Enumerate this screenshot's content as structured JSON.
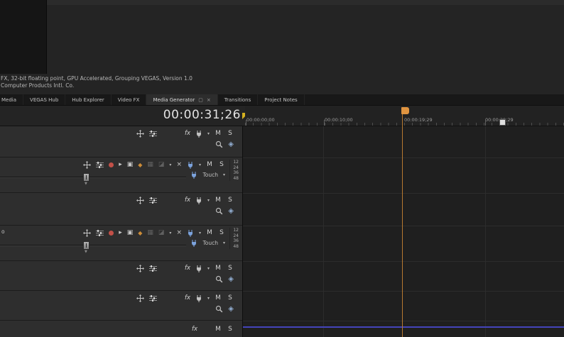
{
  "status_bar": {
    "line1": "FX, 32-bit floating point, GPU Accelerated, Grouping VEGAS, Version 1.0",
    "line2": "Computer Products Intl. Co."
  },
  "tab_bar": {
    "tabs": [
      {
        "label": "Media",
        "active": false
      },
      {
        "label": "VEGAS Hub",
        "active": false
      },
      {
        "label": "Hub Explorer",
        "active": false
      },
      {
        "label": "Video FX",
        "active": false
      },
      {
        "label": "Media Generator",
        "active": true
      },
      {
        "label": "Transitions",
        "active": false
      },
      {
        "label": "Project Notes",
        "active": false
      }
    ]
  },
  "time_display": {
    "value": "00:00:31;26"
  },
  "ruler": {
    "labels": [
      "00:00:00;00",
      "00:00:10;00",
      "00:00:19;29",
      "00:00:29;29"
    ]
  },
  "track_controls": {
    "fx_label": "fx",
    "mute_label": "M",
    "solo_label": "S"
  },
  "tracks": [
    {
      "type": "video"
    },
    {
      "type": "audio",
      "automation_mode": "Touch",
      "meter_scale": [
        "12",
        "24",
        "36",
        "48"
      ]
    },
    {
      "type": "video"
    },
    {
      "type": "audio",
      "automation_mode": "Touch",
      "meter_scale": [
        "12",
        "24",
        "36",
        "48"
      ],
      "name_fragment": "o"
    },
    {
      "type": "video"
    },
    {
      "type": "video"
    },
    {
      "type": "bus"
    }
  ],
  "colors": {
    "marker_orange": "#e09440",
    "marker_line_orange": "#b87a30",
    "bus_track_blue_line": "#4444bb",
    "record_arm_red": "#c25048",
    "cursor_triangle_yellow": "#d4b120",
    "playhead_white": "#dedede",
    "automation_plug_blue": "#7ba2dc"
  }
}
